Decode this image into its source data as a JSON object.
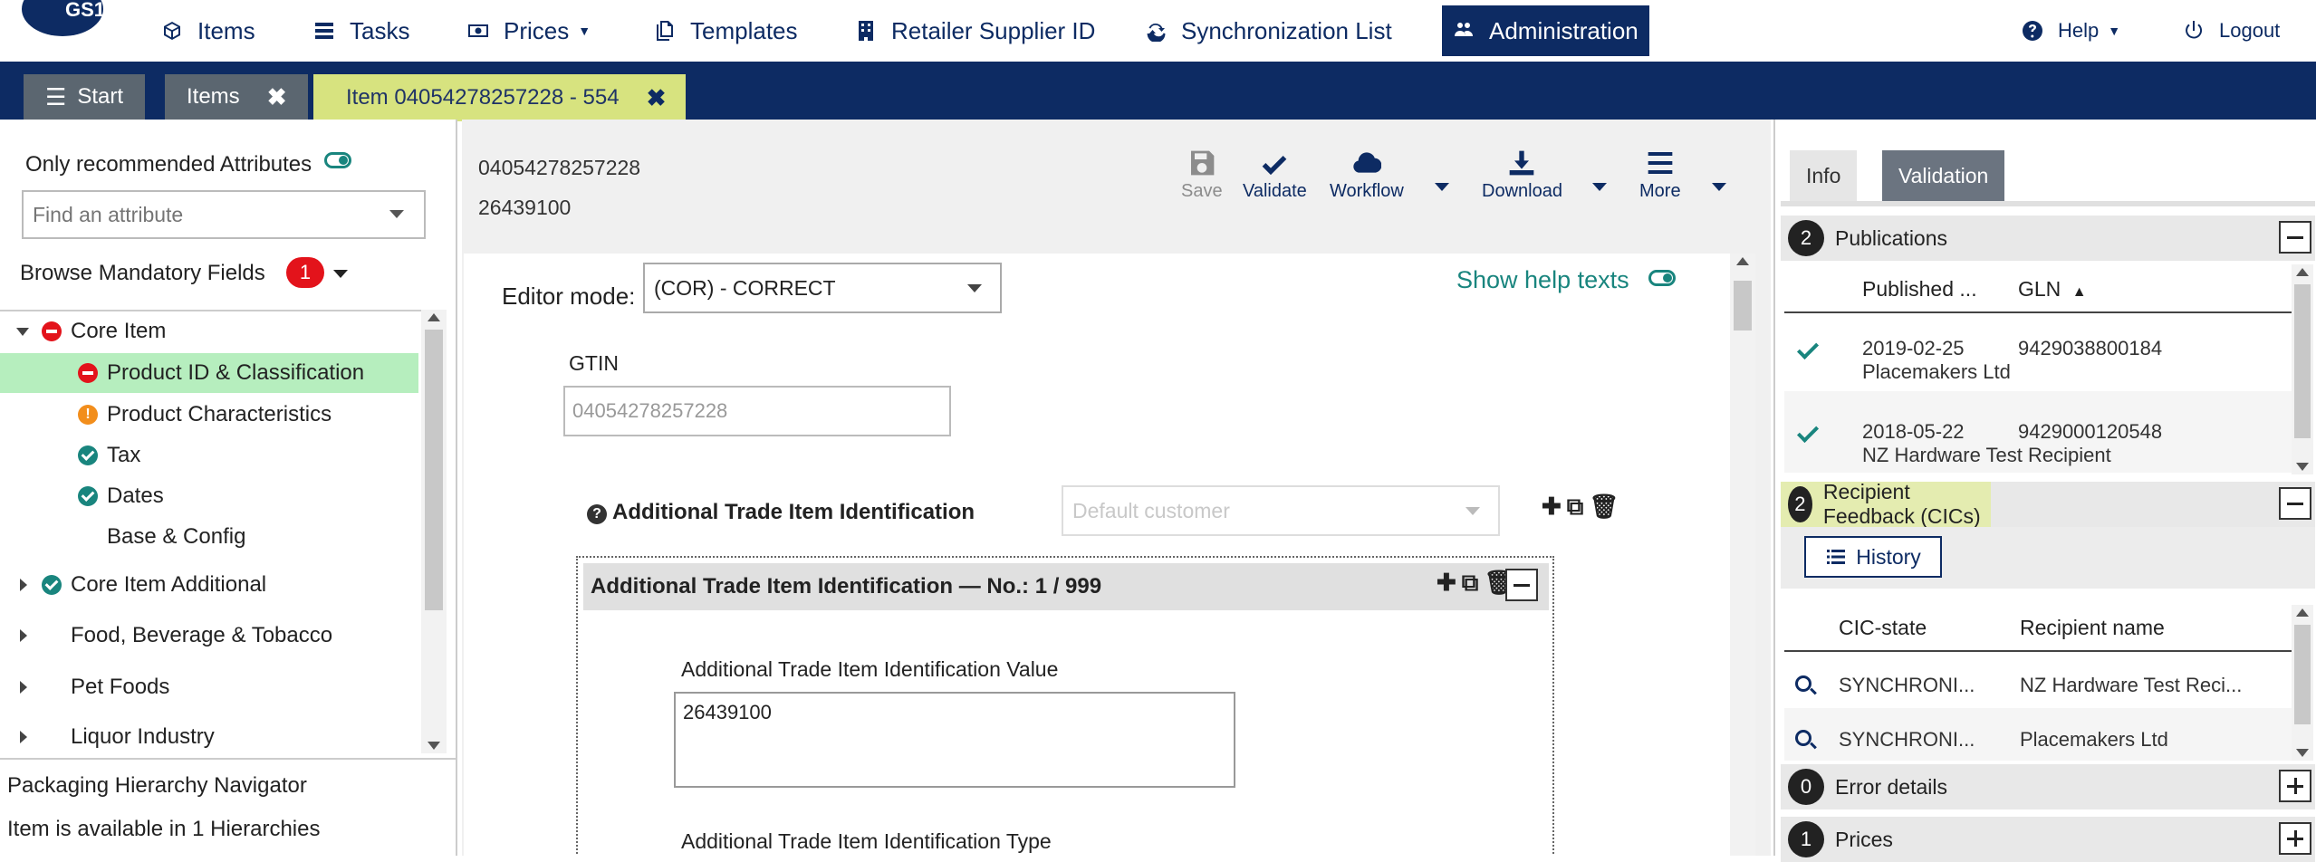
{
  "logo": {
    "text": "GS1"
  },
  "nav": {
    "items": [
      {
        "label": "Items"
      },
      {
        "label": "Tasks"
      },
      {
        "label": "Prices"
      },
      {
        "label": "Templates"
      },
      {
        "label": "Retailer Supplier ID"
      },
      {
        "label": "Synchronization List"
      },
      {
        "label": "Administration"
      }
    ],
    "help": "Help",
    "logout": "Logout"
  },
  "tabs": {
    "start": "Start",
    "items": "Items",
    "current": "Item 04054278257228 - 554"
  },
  "left": {
    "recommended_label": "Only recommended Attributes",
    "attr_search_placeholder": "Find an attribute",
    "browse_label": "Browse Mandatory Fields",
    "browse_count": "1",
    "tree": [
      {
        "label": "Core Item",
        "status": "red"
      },
      {
        "label": "Product ID & Classification",
        "status": "red"
      },
      {
        "label": "Product Characteristics",
        "status": "orange"
      },
      {
        "label": "Tax",
        "status": "green"
      },
      {
        "label": "Dates",
        "status": "green"
      },
      {
        "label": "Base & Config",
        "status": "none"
      },
      {
        "label": "Core Item Additional",
        "status": "green"
      },
      {
        "label": "Food, Beverage & Tobacco",
        "status": "none"
      },
      {
        "label": "Pet Foods",
        "status": "none"
      },
      {
        "label": "Liquor Industry",
        "status": "none"
      }
    ],
    "packaging_title": "Packaging Hierarchy Navigator",
    "packaging_sub": "Item is available in 1 Hierarchies"
  },
  "center": {
    "gtin_line": "04054278257228",
    "code_line": "26439100",
    "toolbar": {
      "save": "Save",
      "validate": "Validate",
      "workflow": "Workflow",
      "download": "Download",
      "more": "More"
    },
    "editor_mode_label": "Editor mode:",
    "editor_mode_value": "(COR) - CORRECT",
    "show_help_texts": "Show help texts",
    "gtin_label": "GTIN",
    "gtin_value": "04054278257228",
    "ati_heading": "Additional Trade Item Identification",
    "customer_placeholder": "Default customer",
    "ati_box_title": "Additional Trade Item Identification — No.: 1 / 999",
    "ati_value_label": "Additional Trade Item Identification Value",
    "ati_value": "26439100",
    "ati_type_label": "Additional Trade Item Identification Type"
  },
  "right": {
    "tab_info": "Info",
    "tab_validation": "Validation",
    "publications": {
      "count": "2",
      "title": "Publications",
      "col_published": "Published ...",
      "col_gln": "GLN",
      "rows": [
        {
          "date": "2019-02-25",
          "gln": "9429038800184",
          "name": "Placemakers Ltd"
        },
        {
          "date": "2018-05-22",
          "gln": "9429000120548",
          "name": "NZ Hardware Test Recipient"
        }
      ]
    },
    "feedback": {
      "count": "2",
      "title": "Recipient Feedback (CICs)",
      "history": "History",
      "col_state": "CIC-state",
      "col_recipient": "Recipient name",
      "rows": [
        {
          "state": "SYNCHRONI...",
          "recipient": "NZ Hardware Test Reci..."
        },
        {
          "state": "SYNCHRONI...",
          "recipient": "Placemakers Ltd"
        }
      ]
    },
    "errors": {
      "count": "0",
      "title": "Error details"
    },
    "prices": {
      "count": "1",
      "title": "Prices"
    }
  }
}
